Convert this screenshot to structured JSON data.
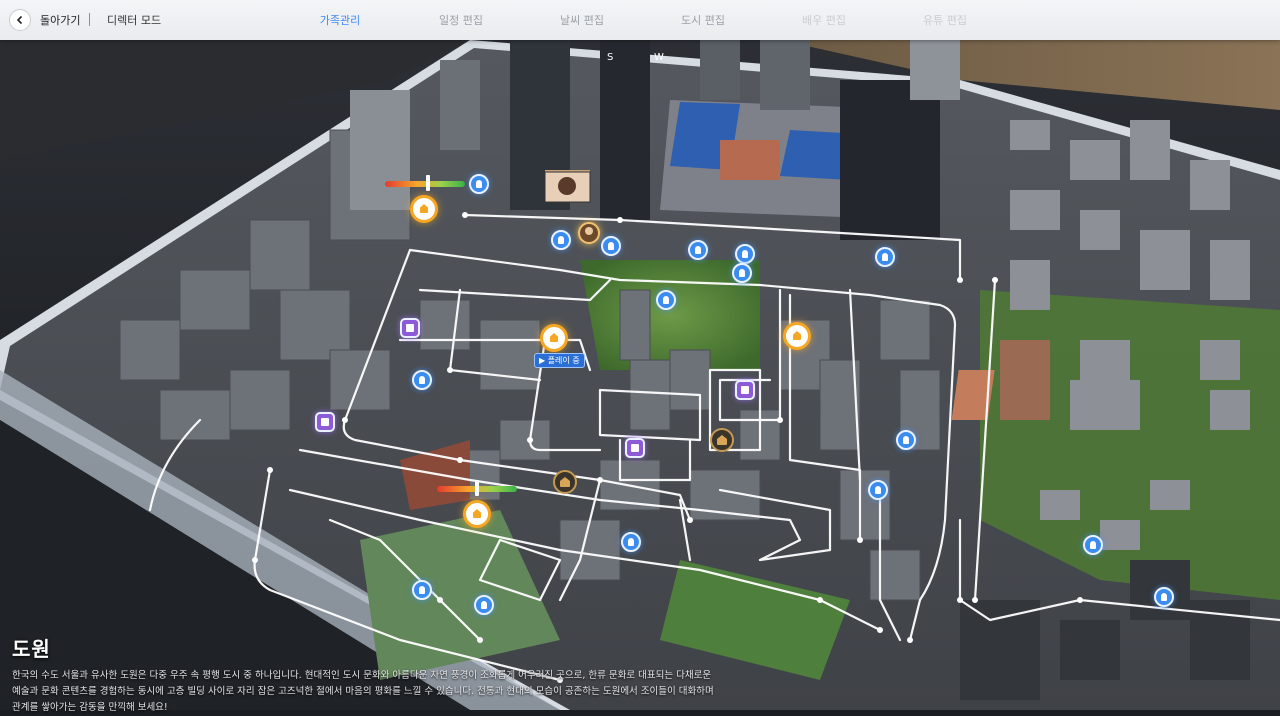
{
  "topbar": {
    "back_icon": "chevron-left-icon",
    "back_label": "돌아가기",
    "mode_label": "디렉터 모드",
    "tabs": [
      {
        "label": "가족관리",
        "state": "active"
      },
      {
        "label": "일정 편집",
        "state": "normal"
      },
      {
        "label": "날씨 편집",
        "state": "normal"
      },
      {
        "label": "도시 편집",
        "state": "normal"
      },
      {
        "label": "배우 편집",
        "state": "faded"
      },
      {
        "label": "유튜 편집",
        "state": "faded"
      }
    ]
  },
  "map": {
    "compass": [
      "S",
      "W"
    ],
    "play_badge": "▶ 플레이 중",
    "marker_icons": {
      "blue": "person-pin-icon",
      "purple": "building-pin-icon",
      "home": "home-pin-icon",
      "dark": "house-outline-icon",
      "avatar": "user-avatar-icon"
    },
    "colors": {
      "route": "#ffffff",
      "blue_marker": "#3b8cf0",
      "purple_marker": "#8d5ad8",
      "home_marker": "#f5a623",
      "active_tab": "#3d8af7"
    }
  },
  "description": {
    "title": "도원",
    "line1": "한국의 수도 서울과 유사한 도원은 다중 우주 속 평행 도시 중 하나입니다. 현대적인 도시 문화와 아름다운 자연 풍경이 조화롭게 어우러진 곳으로, 한류 문화로 대표되는 다채로운",
    "line2": "예술과 문화 콘텐츠를 경험하는 동시에 고층 빌딩 사이로 자리 잡은 고즈넉한 절에서 마음의 평화를 느낄 수 있습니다. 전통과 현대의 모습이 공존하는 도원에서 조이들이 대화하며",
    "line3": "관계를 쌓아가는 감동을 만끽해 보세요!"
  }
}
